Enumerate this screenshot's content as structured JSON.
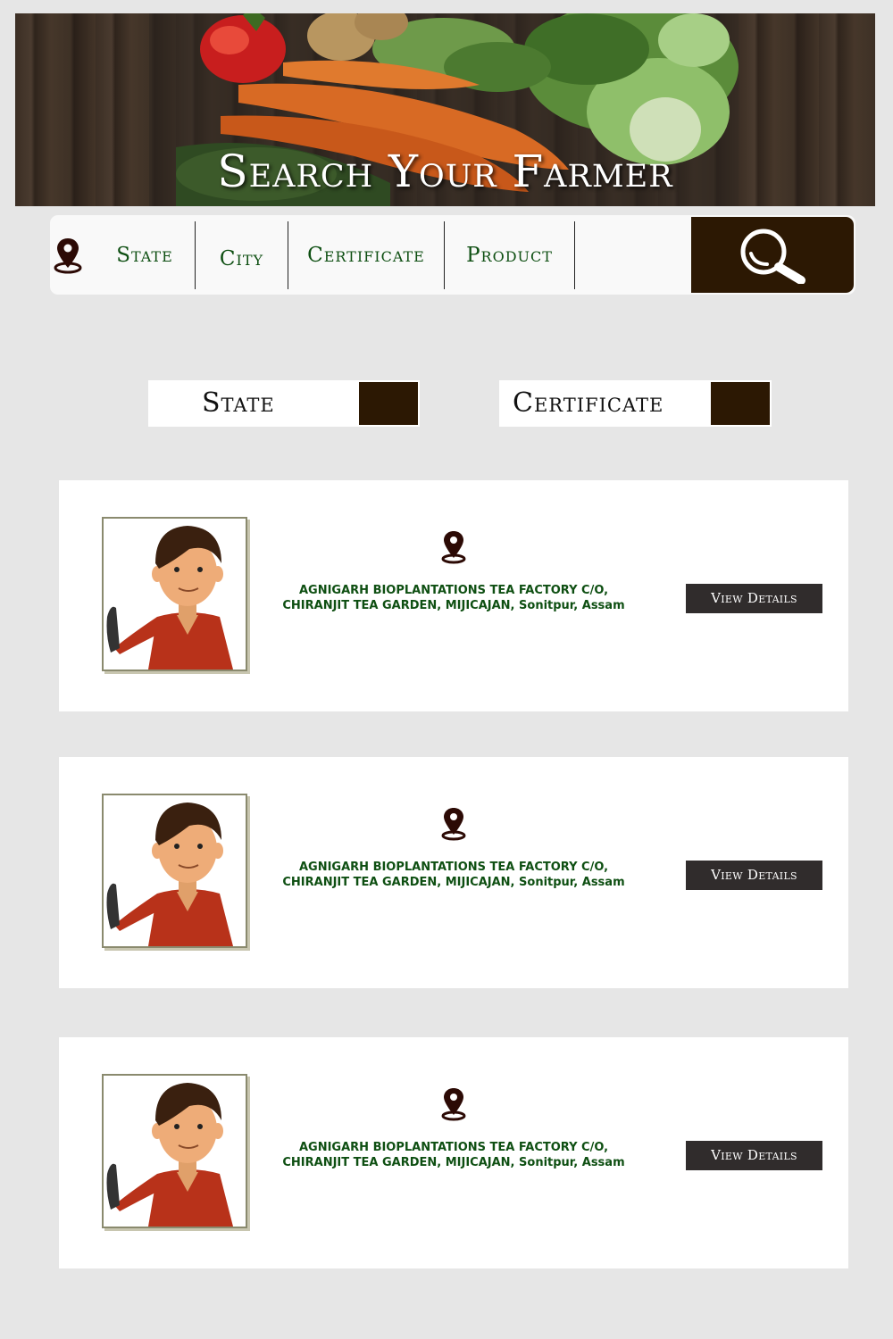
{
  "hero": {
    "title": "Search Your Farmer"
  },
  "search_bar": {
    "location_icon": "map-pin-icon",
    "filters": [
      {
        "label": "State"
      },
      {
        "label": "City"
      },
      {
        "label": "Certificate"
      },
      {
        "label": "Product"
      }
    ],
    "search_icon": "magnifier-icon"
  },
  "selectors": {
    "state": {
      "label": "State"
    },
    "certificate": {
      "label": "Certificate"
    }
  },
  "results": [
    {
      "address": "AGNIGARH BIOPLANTATIONS TEA FACTORY C/O,\nCHIRANJIT TEA GARDEN, MIJICAJAN, Sonitpur, Assam",
      "button_label": "View Details"
    },
    {
      "address": "AGNIGARH BIOPLANTATIONS TEA FACTORY C/O,\nCHIRANJIT TEA GARDEN, MIJICAJAN, Sonitpur, Assam",
      "button_label": "View Details"
    },
    {
      "address": "AGNIGARH BIOPLANTATIONS TEA FACTORY C/O,\nCHIRANJIT TEA GARDEN, MIJICAJAN, Sonitpur, Assam",
      "button_label": "View Details"
    }
  ],
  "colors": {
    "accent_dark": "#2c1803",
    "label_green": "#0e4f12",
    "button_dark": "#302c2c",
    "page_bg": "#e6e6e6"
  }
}
